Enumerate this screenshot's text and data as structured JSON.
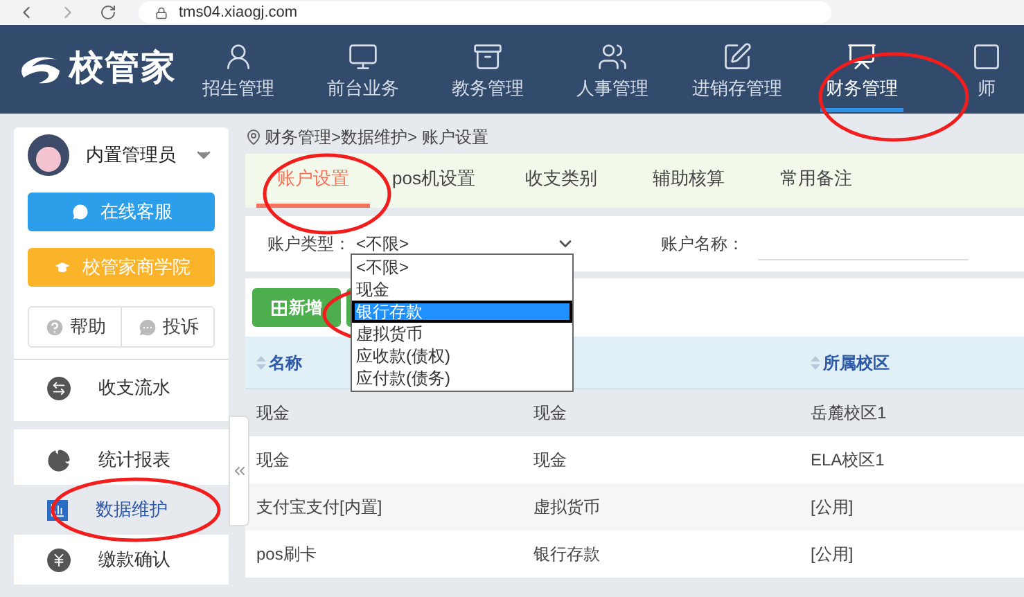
{
  "browser": {
    "url": "tms04.xiaogj.com"
  },
  "logo": {
    "text": "校管家"
  },
  "nav": [
    {
      "label": "招生管理",
      "selected": false
    },
    {
      "label": "前台业务",
      "selected": false
    },
    {
      "label": "教务管理",
      "selected": false
    },
    {
      "label": "人事管理",
      "selected": false
    },
    {
      "label": "进销存管理",
      "selected": false
    },
    {
      "label": "财务管理",
      "selected": true
    },
    {
      "label": "师",
      "selected": false
    }
  ],
  "user": {
    "name": "内置管理员"
  },
  "service_buttons": [
    {
      "label": "在线客服",
      "kind": "chat"
    },
    {
      "label": "校管家商学院",
      "kind": "academy"
    }
  ],
  "help_links": [
    {
      "label": "帮助",
      "kind": "help"
    },
    {
      "label": "投诉",
      "kind": "complain"
    }
  ],
  "menu_groups": [
    [
      {
        "label": "收支流水",
        "kind": "exchange",
        "selected": false
      }
    ],
    [
      {
        "label": "统计报表",
        "kind": "pie",
        "selected": false
      },
      {
        "label": "数据维护",
        "kind": "bars",
        "selected": true
      },
      {
        "label": "缴款确认",
        "kind": "yen",
        "selected": false
      }
    ]
  ],
  "breadcrumb": "财务管理>数据维护> 账户设置",
  "tabs": [
    {
      "label": "账户设置",
      "selected": true
    },
    {
      "label": "pos机设置",
      "selected": false
    },
    {
      "label": "收支类别",
      "selected": false
    },
    {
      "label": "辅助核算",
      "selected": false
    },
    {
      "label": "常用备注",
      "selected": false
    }
  ],
  "filters": {
    "type_label": "账户类型：",
    "type_value": "<不限>",
    "name_label": "账户名称："
  },
  "dropdown": {
    "options": [
      {
        "label": "<不限>",
        "selected": false
      },
      {
        "label": "现金",
        "selected": false
      },
      {
        "label": "银行存款",
        "selected": true
      },
      {
        "label": "虚拟货币",
        "selected": false
      },
      {
        "label": "应收款(债权)",
        "selected": false
      },
      {
        "label": "应付款(债务)",
        "selected": false
      }
    ]
  },
  "add_button": {
    "label": "新增"
  },
  "table": {
    "columns": [
      "名称",
      "",
      "所属校区"
    ],
    "rows": [
      {
        "cells": [
          "现金",
          "现金",
          "岳麓校区1"
        ],
        "highlighted": true
      },
      {
        "cells": [
          "现金",
          "现金",
          "ELA校区1"
        ],
        "highlighted": false
      },
      {
        "cells": [
          "支付宝支付[内置]",
          "虚拟货币",
          "[公用]"
        ],
        "highlighted": false
      },
      {
        "cells": [
          "pos刷卡",
          "银行存款",
          "[公用]"
        ],
        "highlighted": false
      }
    ]
  }
}
